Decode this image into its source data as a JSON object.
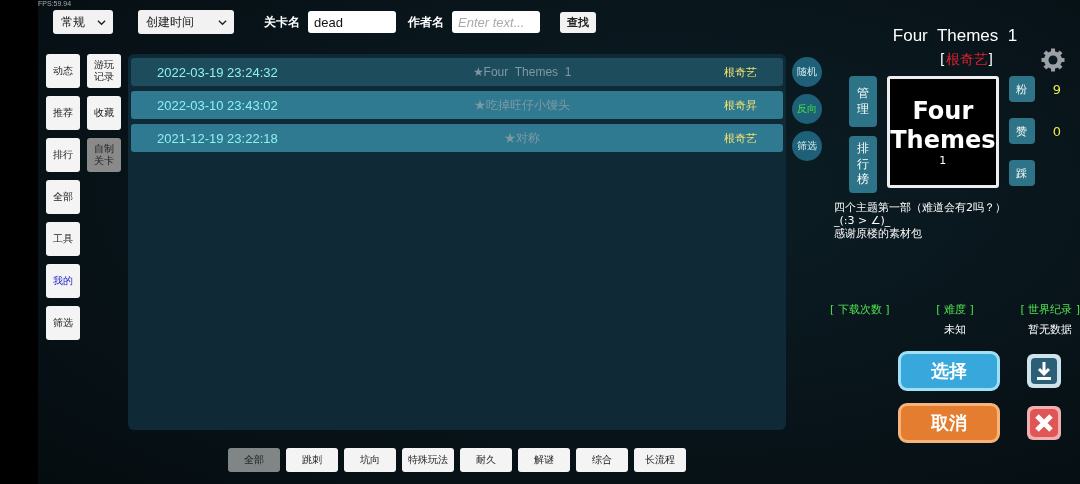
{
  "fps": "FPS:59.94",
  "search": {
    "mode": "常规",
    "sort": "创建时间",
    "level_label": "关卡名",
    "level_value": "dead",
    "author_label": "作者名",
    "author_placeholder": "Enter text...",
    "button": "查找"
  },
  "nav_left": [
    {
      "label": "动态",
      "selected": false
    },
    {
      "label": "推荐",
      "selected": false
    },
    {
      "label": "排行",
      "selected": false
    },
    {
      "label": "全部",
      "selected": false
    },
    {
      "label": "工具",
      "selected": false
    },
    {
      "label": "我的",
      "selected": true
    },
    {
      "label": "筛选",
      "selected": false
    }
  ],
  "nav_right": [
    {
      "label": "游玩记录",
      "selected": false
    },
    {
      "label": "收藏",
      "selected": false
    },
    {
      "label": "自制关卡",
      "selected": true
    }
  ],
  "levels": [
    {
      "date": "2022-03-19 23:24:32",
      "star": "★",
      "title": "Four  Themes  1",
      "author": "根奇艺",
      "selected": true
    },
    {
      "date": "2022-03-10 23:43:02",
      "star": "★",
      "title": "吃掉旺仔小馒头",
      "author": "根奇昇",
      "selected": false
    },
    {
      "date": "2021-12-19 23:22:18",
      "star": "★",
      "title": "对称",
      "author": "根奇艺",
      "selected": false
    }
  ],
  "side_buttons": [
    {
      "label": "随机",
      "on": false
    },
    {
      "label": "反向",
      "on": true
    },
    {
      "label": "筛选",
      "on": false
    }
  ],
  "categories": [
    {
      "label": "全部",
      "selected": true
    },
    {
      "label": "跳刺",
      "selected": false
    },
    {
      "label": "坑向",
      "selected": false
    },
    {
      "label": "特殊玩法",
      "selected": false
    },
    {
      "label": "耐久",
      "selected": false
    },
    {
      "label": "解谜",
      "selected": false
    },
    {
      "label": "综合",
      "selected": false
    },
    {
      "label": "长流程",
      "selected": false
    }
  ],
  "detail": {
    "title": "Four  Themes  1",
    "author_open": "[",
    "author": "根奇艺",
    "author_close": "]",
    "left_buttons": [
      "管理",
      "排行榜"
    ],
    "thumb_lines": [
      "Four",
      "Themes"
    ],
    "thumb_sub": "1",
    "counters": [
      {
        "label": "粉",
        "value": "9"
      },
      {
        "label": "赞",
        "value": "0"
      },
      {
        "label": "踩"
      }
    ],
    "description": [
      "四个主题第一部（难道会有2吗？）",
      "_(:3 > ∠)_",
      "感谢原楼的素材包"
    ],
    "stats": [
      {
        "label": "[ 下载次数 ]"
      },
      {
        "label": "[ 难度 ]",
        "value": "未知"
      },
      {
        "label": "[ 世界纪录 ]",
        "value": "暂无数据"
      }
    ],
    "select_button": "选择",
    "cancel_button": "取消"
  }
}
